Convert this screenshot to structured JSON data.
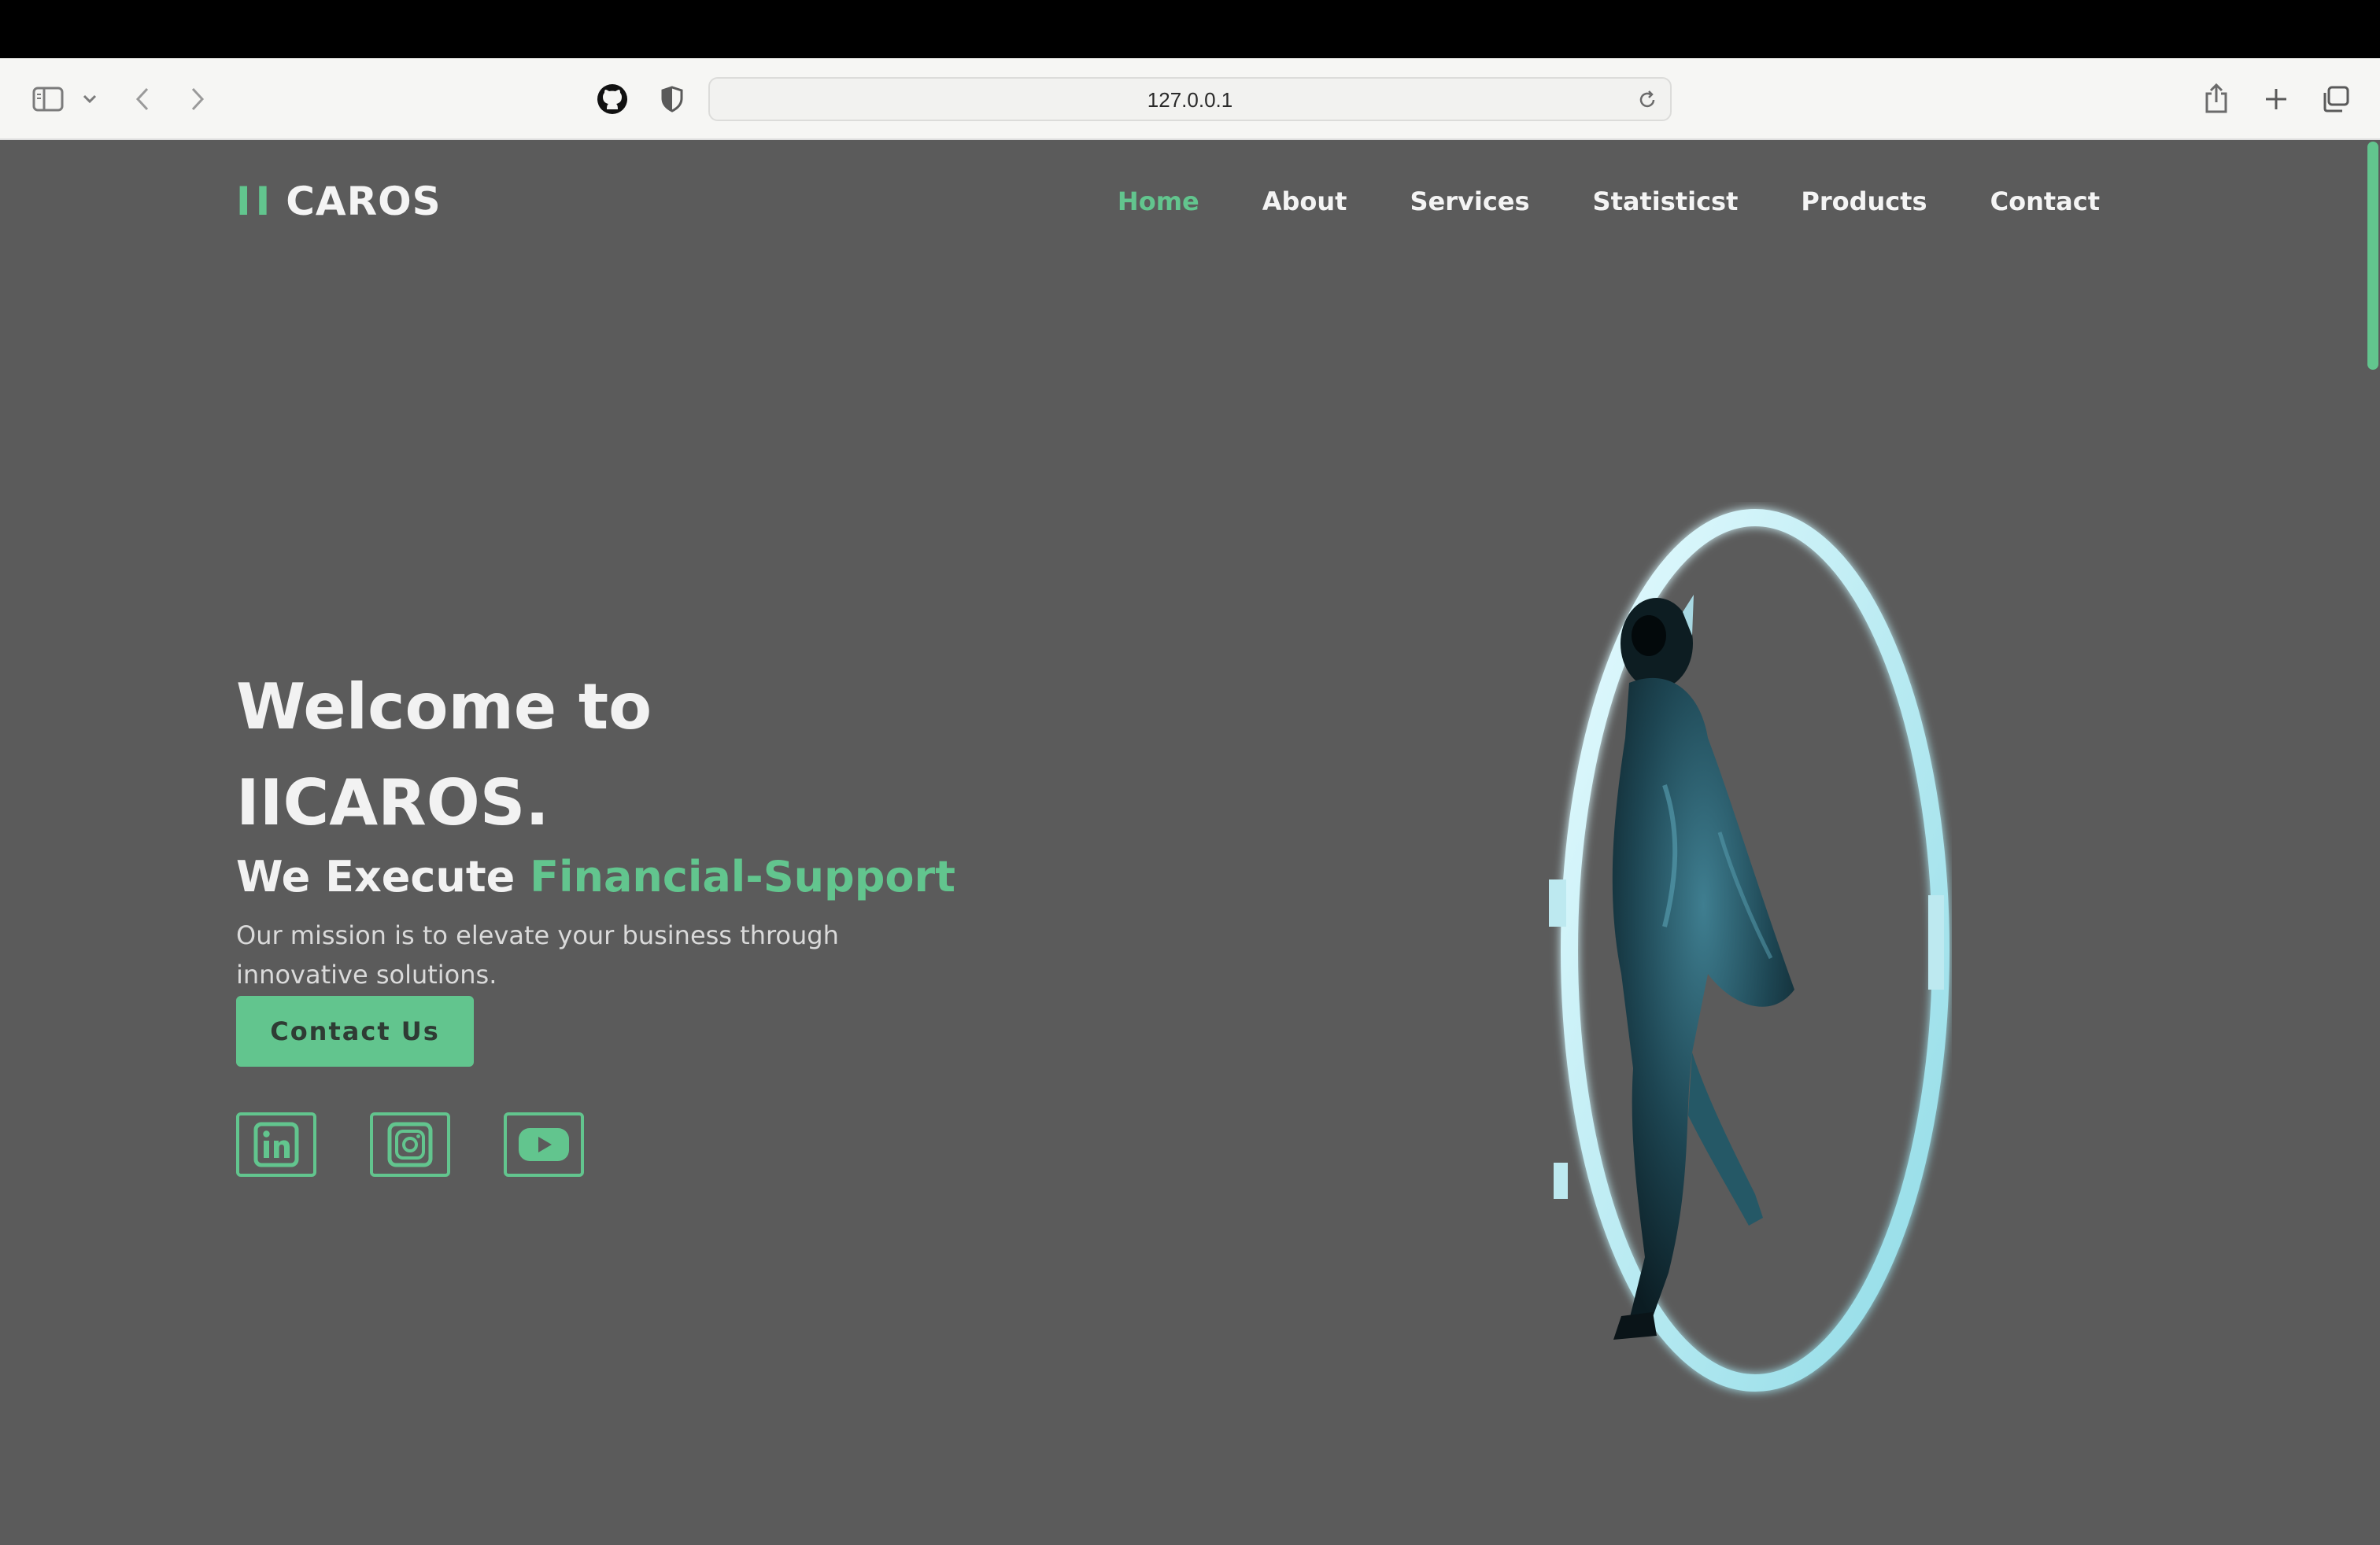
{
  "browser": {
    "url": "127.0.0.1",
    "icons": [
      "sidebar-icon",
      "chevron-down-icon",
      "back-icon",
      "forward-icon",
      "github-icon",
      "shield-icon",
      "reload-icon",
      "share-icon",
      "new-tab-icon",
      "tabs-overview-icon"
    ]
  },
  "site": {
    "logo_mark": "II",
    "logo_text": "CAROS",
    "accent_color": "#62c58e",
    "background_color": "#5b5b5b"
  },
  "nav": {
    "items": [
      {
        "label": "Home",
        "active": true
      },
      {
        "label": "About",
        "active": false
      },
      {
        "label": "Services",
        "active": false
      },
      {
        "label": "Statisticst",
        "active": false
      },
      {
        "label": "Products",
        "active": false
      },
      {
        "label": "Contact",
        "active": false
      }
    ]
  },
  "hero": {
    "title_line1": "Welcome to",
    "title_line2": "IICAROS.",
    "tagline_prefix": "We Execute",
    "tagline_accent": "Financial-Support",
    "mission": "Our mission is to elevate your business through innovative solutions.",
    "cta_label": "Contact Us",
    "socials": [
      "linkedin-icon",
      "instagram-icon",
      "youtube-icon"
    ],
    "image": "hooded-figure-in-glowing-portal"
  }
}
